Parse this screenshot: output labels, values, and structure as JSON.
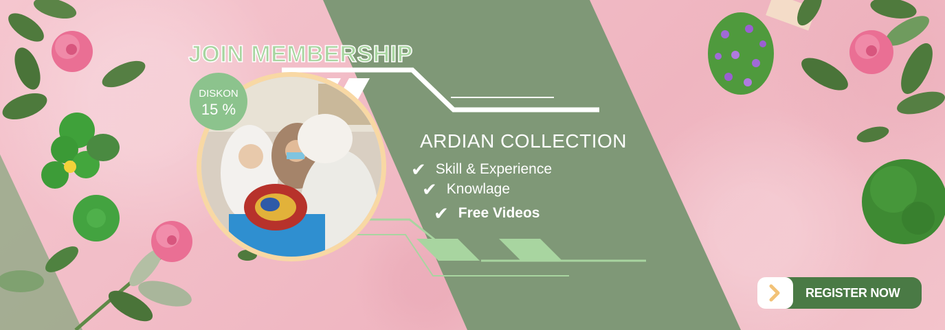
{
  "banner": {
    "title": "JOIN MEMBERSHIP",
    "badge": {
      "label": "DISKON",
      "value": "15 %"
    },
    "brand": "ARDIAN COLLECTION",
    "features": [
      "Skill & Experience",
      "Knowlage",
      "Free Videos"
    ],
    "cta": {
      "label": "REGISTER NOW",
      "icon": "chevron-right-icon"
    }
  },
  "colors": {
    "pink_background": "#f2bcc5",
    "green_panel": "#7f9877",
    "light_green": "#a8d5a0",
    "dark_green_button": "#4a7a45",
    "photo_border": "#f8d8a4",
    "chevron": "#f2c277"
  }
}
